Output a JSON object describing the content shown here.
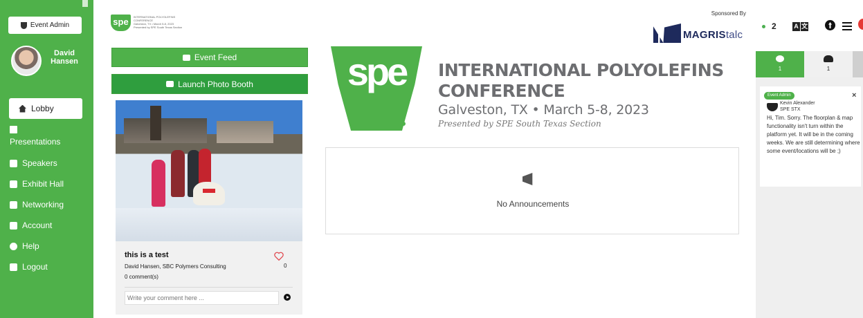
{
  "sidebar": {
    "admin_button": "Event Admin",
    "user_name": "David Hansen",
    "items": [
      {
        "label": "Lobby",
        "icon": "home-icon"
      },
      {
        "label": "Presentations",
        "icon": "calendar-icon"
      },
      {
        "label": "Speakers",
        "icon": "speaker-icon"
      },
      {
        "label": "Exhibit Hall",
        "icon": "booth-icon"
      },
      {
        "label": "Networking",
        "icon": "people-icon"
      },
      {
        "label": "Account",
        "icon": "gear-icon"
      },
      {
        "label": "Help",
        "icon": "info-icon"
      },
      {
        "label": "Logout",
        "icon": "logout-icon"
      }
    ]
  },
  "header": {
    "small_logo": "spe",
    "small_logo_lines": [
      "INTERNATIONAL POLYOLEFINS",
      "CONFERENCE",
      "Galveston, TX • March 5-8, 2023",
      "Presented by SPE South Texas Section"
    ],
    "sponsor_label": "Sponsored By",
    "sponsor_name_bold": "MAGRIS",
    "sponsor_name_light": "talc"
  },
  "feed": {
    "event_feed_button": "Event Feed",
    "photo_booth_button": "Launch Photo Booth",
    "post": {
      "title": "this is a test",
      "author": "David Hansen, SBC Polymers Consulting",
      "comments": "0 comment(s)",
      "likes": "0",
      "comment_placeholder": "Write your comment here ..."
    }
  },
  "banner": {
    "logo": "spe",
    "title": "INTERNATIONAL POLYOLEFINS CONFERENCE",
    "dates": "Galveston, TX • March 5-8, 2023",
    "presented": "Presented by SPE South Texas Section"
  },
  "announcements": {
    "empty_text": "No Announcements"
  },
  "topbar": {
    "online_count": "2",
    "translate_letters": [
      "A",
      "文"
    ]
  },
  "panel": {
    "tabs": [
      {
        "count": "1",
        "icon": "chat-icon"
      },
      {
        "count": "1",
        "icon": "people-icon"
      }
    ],
    "message": {
      "role": "Event Admin",
      "name": "Kevin Alexander",
      "org": "SPE STX",
      "body": "Hi, Tim. Sorry. The floorplan & map functionality isn't turn within the platform yet. It will be in the coming weeks. We are still determining where some event/locations will be ;)"
    }
  },
  "colors": {
    "brand_green": "#4fb14a",
    "photo_booth_green": "#2f9e3e",
    "sponsor_navy": "#1e2a5c"
  }
}
